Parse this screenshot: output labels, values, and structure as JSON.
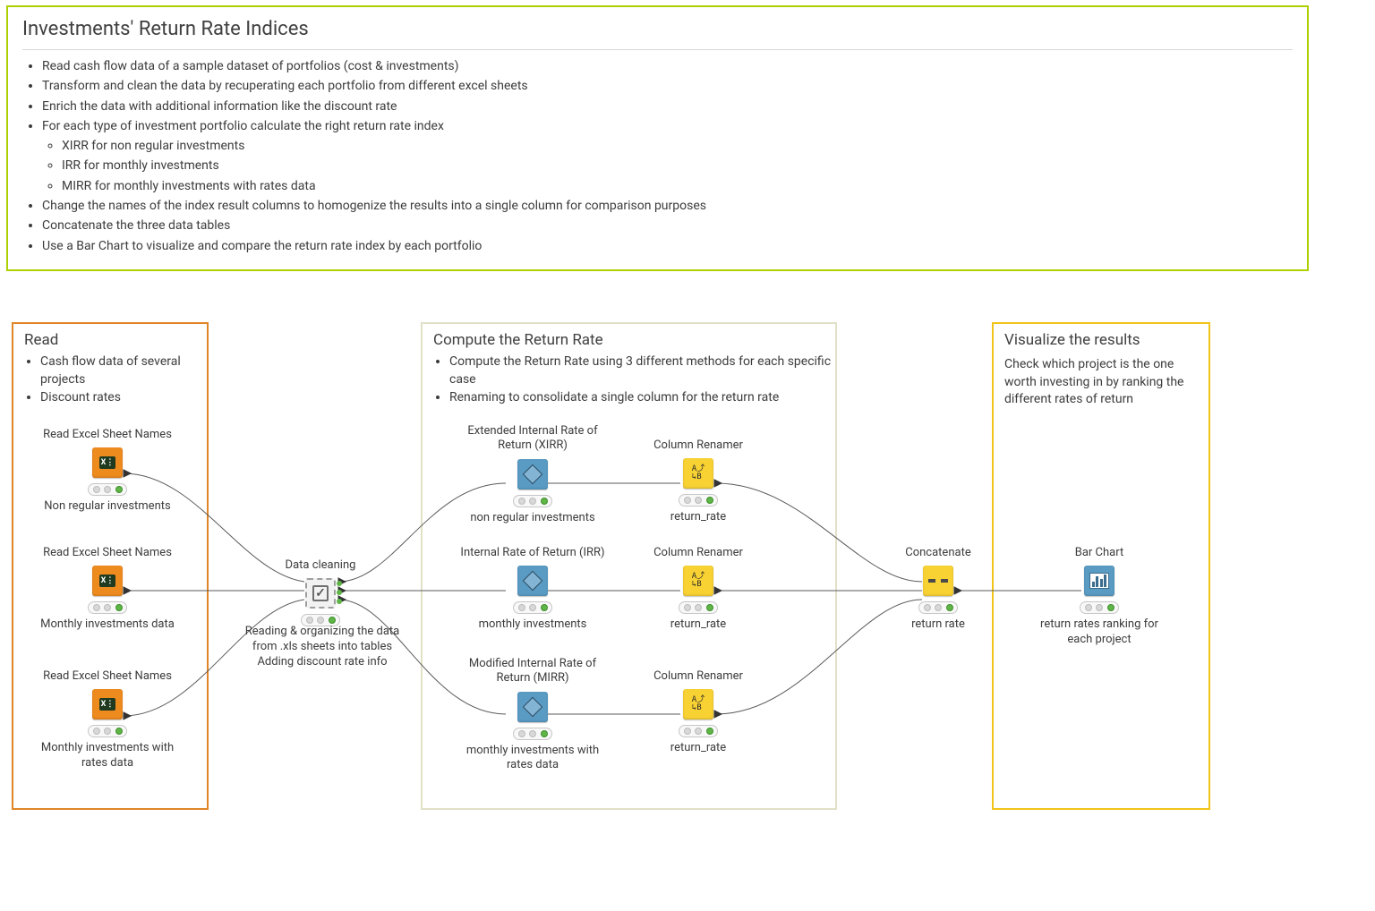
{
  "description": {
    "title": "Investments' Return Rate Indices",
    "bullets": [
      "Read cash flow data of a sample dataset of portfolios (cost & investments)",
      "Transform and clean the data by recuperating each portfolio from different excel sheets",
      "Enrich the data with additional information like the discount rate",
      "For each type of investment portfolio calculate the right return rate index"
    ],
    "sub_bullets": [
      "XIRR for non regular investments",
      "IRR for monthly investments",
      "MIRR for monthly investments with rates data"
    ],
    "bullets_tail": [
      "Change the names of the index result columns to homogenize the results into a single column for comparison purposes",
      "Concatenate the three data tables",
      "Use a Bar Chart to visualize and compare the return rate index by each portfolio"
    ]
  },
  "groups": {
    "read": {
      "title": "Read",
      "items": [
        "Cash flow data of several projects",
        "Discount rates"
      ]
    },
    "compute": {
      "title": "Compute the Return Rate",
      "items": [
        "Compute the Return Rate using 3 different methods for each specific case",
        "Renaming to consolidate a single column for the return rate"
      ]
    },
    "visualize": {
      "title": "Visualize the results",
      "text": "Check which project is the one worth investing in by ranking the different rates of return"
    }
  },
  "nodes": {
    "read1": {
      "title": "Read Excel Sheet Names",
      "caption": "Non regular investments"
    },
    "read2": {
      "title": "Read Excel Sheet Names",
      "caption": "Monthly investments data"
    },
    "read3": {
      "title": "Read Excel Sheet Names",
      "caption": "Monthly investments with rates data"
    },
    "clean": {
      "title": "Data cleaning",
      "caption": "Reading & organizing the data from .xls sheets into tables Adding discount rate info"
    },
    "xirr": {
      "title": "Extended Internal Rate of Return (XIRR)",
      "caption": "non regular investments"
    },
    "irr": {
      "title": "Internal Rate of Return (IRR)",
      "caption": "monthly investments"
    },
    "mirr": {
      "title": "Modified Internal Rate of Return (MIRR)",
      "caption": "monthly investments with rates data"
    },
    "ren1": {
      "title": "Column Renamer",
      "caption": "return_rate"
    },
    "ren2": {
      "title": "Column Renamer",
      "caption": "return_rate"
    },
    "ren3": {
      "title": "Column Renamer",
      "caption": "return_rate"
    },
    "concat": {
      "title": "Concatenate",
      "caption": "return rate"
    },
    "bar": {
      "title": "Bar Chart",
      "caption": "return rates ranking for each project"
    }
  }
}
